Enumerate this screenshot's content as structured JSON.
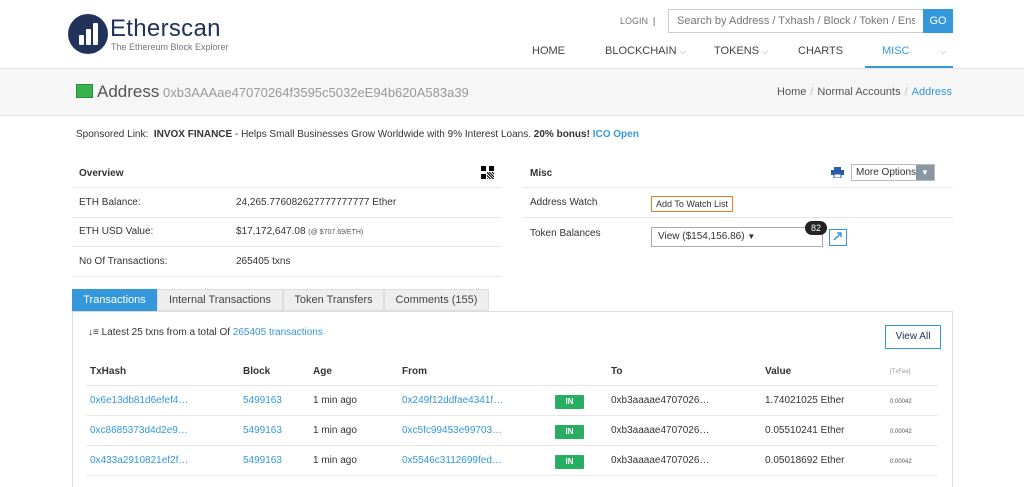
{
  "header": {
    "logo_name": "Etherscan",
    "logo_tagline": "The Ethereum Block Explorer",
    "login_label": "LOGIN",
    "search_placeholder": "Search by Address / Txhash / Block / Token / Ens",
    "search_button": "GO",
    "nav": [
      "HOME",
      "BLOCKCHAIN",
      "TOKENS",
      "CHARTS",
      "MISC"
    ],
    "nav_active": "MISC"
  },
  "page": {
    "title": "Address",
    "address": "0xb3AAAae47070264f3595c5032eE94b620A583a39",
    "breadcrumb": [
      "Home",
      "Normal Accounts",
      "Address"
    ]
  },
  "sponsored": {
    "label": "Sponsored Link:",
    "brand": "INVOX FINANCE",
    "text": " - Helps Small Businesses Grow Worldwide with 9% Interest Loans. ",
    "bonus": "20% bonus!",
    "link": "ICO Open"
  },
  "overview": {
    "title": "Overview",
    "rows": [
      {
        "label": "ETH Balance:",
        "value": "24,265.776082627777777777 Ether",
        "note": ""
      },
      {
        "label": "ETH USD Value:",
        "value": "$17,172,647.08",
        "note": "(@ $707.69/ETH)"
      },
      {
        "label": "No Of Transactions:",
        "value": "265405 txns",
        "note": ""
      }
    ]
  },
  "misc": {
    "title": "Misc",
    "more_options": "More Options",
    "address_watch_label": "Address Watch",
    "watch_button": "Add To Watch List",
    "token_balances_label": "Token Balances",
    "token_view": "View ($154,156.86)",
    "token_count": "82"
  },
  "tabs": [
    "Transactions",
    "Internal Transactions",
    "Token Transfers",
    "Comments (155)"
  ],
  "transactions": {
    "summary_prefix": "Latest 25 txns from a total Of ",
    "summary_link": "265405 transactions",
    "view_all": "View All",
    "columns": [
      "TxHash",
      "Block",
      "Age",
      "From",
      "",
      "To",
      "Value",
      "[TxFee]"
    ],
    "rows": [
      {
        "hash": "0x6e13db81d6efef4…",
        "block": "5499163",
        "age": "1 min ago",
        "from": "0x249f12ddfae4341f…",
        "dir": "IN",
        "to": "0xb3aaaae4707026…",
        "value": "1.74021025 Ether",
        "fee": "0.00042"
      },
      {
        "hash": "0xc8685373d4d2e9…",
        "block": "5499163",
        "age": "1 min ago",
        "from": "0xc5fc99453e99703…",
        "dir": "IN",
        "to": "0xb3aaaae4707026…",
        "value": "0.05510241 Ether",
        "fee": "0.00042"
      },
      {
        "hash": "0x433a2910821ef2f…",
        "block": "5499163",
        "age": "1 min ago",
        "from": "0x5546c3112699fed…",
        "dir": "IN",
        "to": "0xb3aaaae4707026…",
        "value": "0.05018692 Ether",
        "fee": "0.00042"
      }
    ]
  },
  "colors": {
    "accent": "#3498db",
    "brand_dark": "#21325b",
    "in_badge": "#27ae60",
    "watch_border": "#e67e22"
  }
}
